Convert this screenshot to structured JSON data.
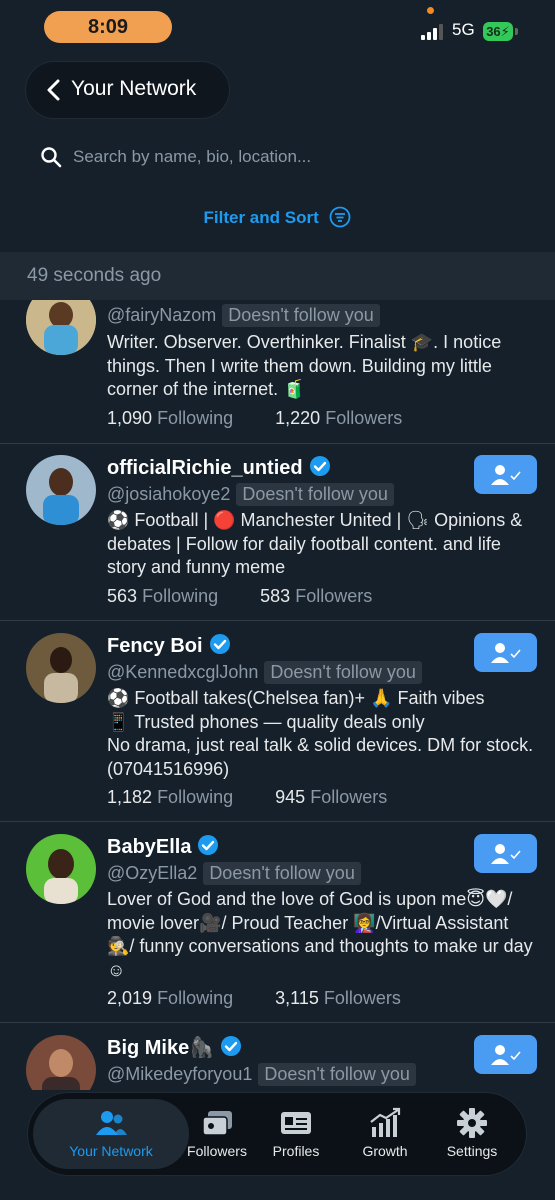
{
  "status_bar": {
    "time": "8:09",
    "network": "5G",
    "battery": "36"
  },
  "header": {
    "title": "Your Network",
    "search_placeholder": "Search by name, bio, location...",
    "filter_label": "Filter and Sort",
    "updated": "49 seconds ago"
  },
  "accounts": [
    {
      "name": "",
      "handle": "@fairyNazom",
      "badge": "Doesn't follow you",
      "bio": "Writer. Observer. Overthinker. Finalist 🎓. I notice things. Then I write them down. Building my little corner of the internet. 🧃",
      "following": "1,090",
      "following_label": "Following",
      "followers": "1,220",
      "followers_label": "Followers"
    },
    {
      "name": "officialRichie_untied",
      "handle": "@josiahokoye2",
      "badge": "Doesn't follow you",
      "bio": "⚽ Football | 🔴 Manchester United | 🗣 Opinions & debates | Follow for daily football content. and life story and funny meme",
      "following": "563",
      "following_label": "Following",
      "followers": "583",
      "followers_label": "Followers"
    },
    {
      "name": "Fency Boi",
      "handle": "@KennedxcglJohn",
      "badge": "Doesn't follow you",
      "bio": "⚽ Football takes(Chelsea fan)+ 🙏 Faith vibes\n📱 Trusted phones — quality deals only\nNo drama, just real talk & solid devices. DM for stock.(07041516996)",
      "following": "1,182",
      "following_label": "Following",
      "followers": "945",
      "followers_label": "Followers"
    },
    {
      "name": "BabyElla",
      "handle": "@OzyElla2",
      "badge": "Doesn't follow you",
      "bio": "Lover of God and the love of God is upon me😇🤍/ movie lover🎥/ Proud Teacher 👩‍🏫/Virtual Assistant 🕵/ funny conversations and thoughts to make ur day☺",
      "following": "2,019",
      "following_label": "Following",
      "followers": "3,115",
      "followers_label": "Followers"
    },
    {
      "name": "Big Mike🦍",
      "handle": "@Mikedeyforyou1",
      "badge": "Doesn't follow you",
      "bio": "",
      "following": "",
      "following_label": "",
      "followers": "",
      "followers_label": ""
    }
  ],
  "nav": {
    "tabs": [
      {
        "label": "Your Network",
        "icon": "users-icon",
        "active": true
      },
      {
        "label": "Followers",
        "icon": "followers-cards-icon"
      },
      {
        "label": "Profiles",
        "icon": "id-card-icon"
      },
      {
        "label": "Growth",
        "icon": "growth-chart-icon"
      },
      {
        "label": "Settings",
        "icon": "gear-icon"
      }
    ]
  },
  "colors": {
    "background": "#15202b",
    "accent": "#1d9bf0",
    "follow_button": "#4a9bf2",
    "time_pill": "#f0a050",
    "battery": "#34c759"
  }
}
